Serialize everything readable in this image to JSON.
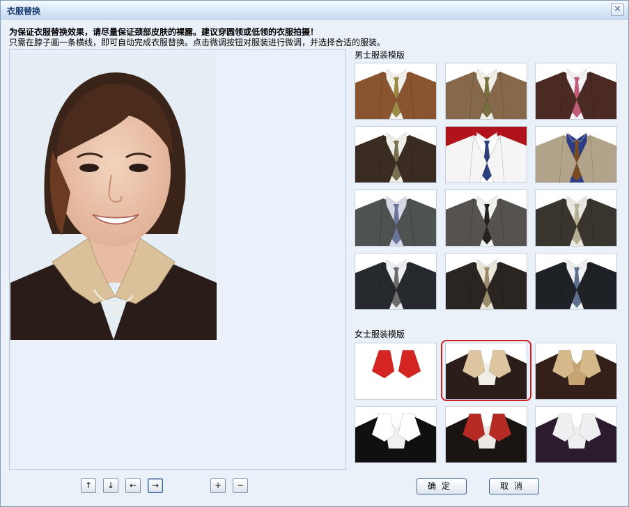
{
  "window": {
    "title": "衣服替换",
    "close_glyph": "✕"
  },
  "instructions": {
    "line1": "为保证衣服替换效果，请尽量保证颈部皮肤的裸露。建议穿圆领或低领的衣服拍摄！",
    "line2": "只需在脖子画一条横线，即可自动完成衣服替换。点击微调按钮对服装进行微调，并选择合适的服装。"
  },
  "men": {
    "label": "男士服装模版",
    "items": [
      {
        "suit": "#8a5430",
        "shirt": "#f4f1ea",
        "tie": "#9b8a48",
        "bg": "#ffffff"
      },
      {
        "suit": "#86684a",
        "shirt": "#f2efe6",
        "tie": "#77703f",
        "bg": "#ffffff"
      },
      {
        "suit": "#4a2a22",
        "shirt": "#f3f3f6",
        "tie": "#c05c7a",
        "bg": "#ffffff"
      },
      {
        "suit": "#3a2c22",
        "shirt": "#f1efe9",
        "tie": "#777050",
        "bg": "#ffffff"
      },
      {
        "suit": "#f5f5f5",
        "shirt": "#ffffff",
        "tie": "#2b3d7a",
        "bg": "#b0131a"
      },
      {
        "suit": "#b2a48a",
        "shirt": "#2d3e86",
        "tie": "#7a4b22",
        "bg": "#ffffff"
      },
      {
        "suit": "#4e5250",
        "shirt": "#d6d8e8",
        "tie": "#6a7698",
        "bg": "#ffffff"
      },
      {
        "suit": "#56524f",
        "shirt": "#f1f1ee",
        "tie": "#222222",
        "bg": "#ffffff"
      },
      {
        "suit": "#39342d",
        "shirt": "#e9e7e0",
        "tie": "#b5ae92",
        "bg": "#ffffff"
      },
      {
        "suit": "#26292e",
        "shirt": "#eef0f3",
        "tie": "#6c6c6c",
        "bg": "#ffffff"
      },
      {
        "suit": "#2a2520",
        "shirt": "#ece6da",
        "tie": "#9a8c6a",
        "bg": "#ffffff"
      },
      {
        "suit": "#1e2125",
        "shirt": "#eff1f5",
        "tie": "#5c708e",
        "bg": "#ffffff"
      }
    ]
  },
  "women": {
    "label": "女士服装模版",
    "items": [
      {
        "suit": "#ffffff",
        "shirt": "#d42521",
        "tie": "#ffffff",
        "bg": "#ffffff"
      },
      {
        "suit": "#2b1d19",
        "shirt": "#ddc59f",
        "tie": "#f1eee8",
        "bg": "#ffffff"
      },
      {
        "suit": "#342018",
        "shirt": "#d6b98a",
        "tie": "#c8a472",
        "bg": "#ffffff"
      },
      {
        "suit": "#101010",
        "shirt": "#ffffff",
        "tie": "#f0f0f0",
        "bg": "#ffffff"
      },
      {
        "suit": "#1a1512",
        "shirt": "#b52b24",
        "tie": "#ece7e2",
        "bg": "#ffffff"
      },
      {
        "suit": "#2c1a2e",
        "shirt": "#efeef0",
        "tie": "#efeef0",
        "bg": "#ffffff"
      }
    ],
    "selected_index": 1
  },
  "controls": {
    "up": "↑",
    "down": "↓",
    "left": "←",
    "right": "→",
    "zoom_in": "+",
    "zoom_out": "−",
    "confirm": "确定",
    "cancel": "取消"
  },
  "colors": {
    "accent": "#d21e1e",
    "border": "#7f9db9",
    "background": "#eaf1f9"
  }
}
